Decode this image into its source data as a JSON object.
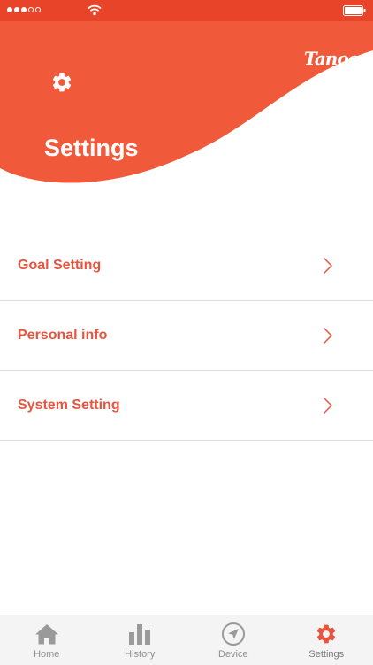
{
  "colors": {
    "accent": "#e8553e",
    "header": "#f05a3b",
    "tab_inactive": "#9a9a9a",
    "tab_active": "#e8553e"
  },
  "status_bar": {
    "signal_icon": "signal-dots-icon",
    "wifi_icon": "wifi-icon",
    "battery_icon": "battery-icon"
  },
  "header": {
    "logo": "Tanoo",
    "title": "Settings",
    "icon": "gear-icon"
  },
  "menu": {
    "items": [
      {
        "label": "Goal Setting",
        "icon": "chevron-right-icon"
      },
      {
        "label": "Personal info",
        "icon": "chevron-right-icon"
      },
      {
        "label": "System Setting",
        "icon": "chevron-right-icon"
      }
    ]
  },
  "tab_bar": {
    "tabs": [
      {
        "label": "Home",
        "icon": "home-icon",
        "active": false
      },
      {
        "label": "History",
        "icon": "bar-chart-icon",
        "active": false
      },
      {
        "label": "Device",
        "icon": "navigation-icon",
        "active": false
      },
      {
        "label": "Settings",
        "icon": "gear-icon",
        "active": true
      }
    ]
  }
}
